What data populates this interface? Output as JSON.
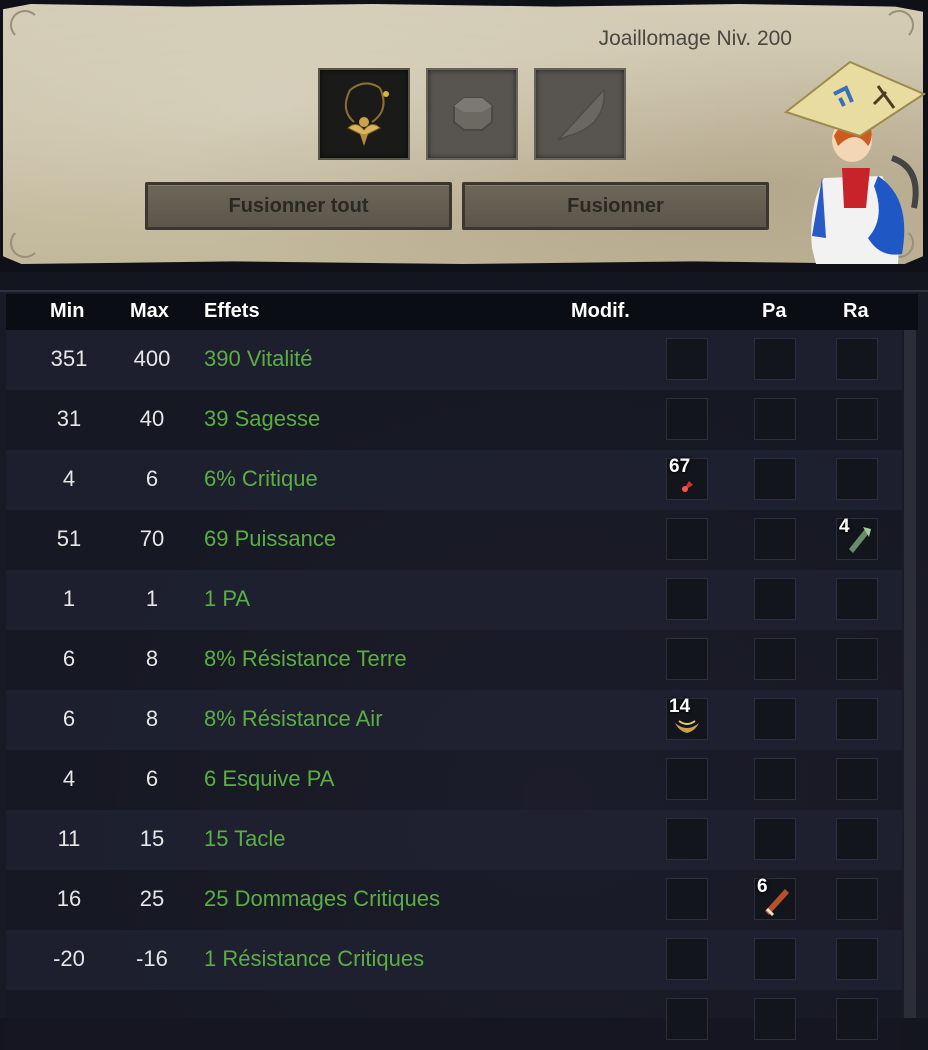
{
  "header": {
    "job_title": "Joaillomage Niv. 200",
    "slots": [
      {
        "icon": "amulet-icon",
        "state": "filled"
      },
      {
        "icon": "rune-slot-icon",
        "state": "empty"
      },
      {
        "icon": "feather-icon",
        "state": "empty"
      }
    ],
    "buttons": {
      "merge_all": "Fusionner tout",
      "merge": "Fusionner"
    }
  },
  "table": {
    "columns": {
      "min": "Min",
      "max": "Max",
      "effects": "Effets",
      "modif": "Modif.",
      "pa": "Pa",
      "ra": "Ra"
    },
    "rows": [
      {
        "min": "351",
        "max": "400",
        "effect": "390 Vitalité",
        "modif": "",
        "pa": "",
        "ra": ""
      },
      {
        "min": "31",
        "max": "40",
        "effect": "39 Sagesse",
        "modif": "",
        "pa": "",
        "ra": ""
      },
      {
        "min": "4",
        "max": "6",
        "effect": "6% Critique",
        "modif": "67",
        "pa": "",
        "ra": ""
      },
      {
        "min": "51",
        "max": "70",
        "effect": "69 Puissance",
        "modif": "",
        "pa": "",
        "ra": "4"
      },
      {
        "min": "1",
        "max": "1",
        "effect": "1 PA",
        "modif": "",
        "pa": "",
        "ra": ""
      },
      {
        "min": "6",
        "max": "8",
        "effect": "8% Résistance Terre",
        "modif": "",
        "pa": "",
        "ra": ""
      },
      {
        "min": "6",
        "max": "8",
        "effect": "8% Résistance Air",
        "modif": "14",
        "pa": "",
        "ra": ""
      },
      {
        "min": "4",
        "max": "6",
        "effect": "6 Esquive PA",
        "modif": "",
        "pa": "",
        "ra": ""
      },
      {
        "min": "11",
        "max": "15",
        "effect": "15 Tacle",
        "modif": "",
        "pa": "",
        "ra": ""
      },
      {
        "min": "16",
        "max": "25",
        "effect": "25 Dommages Critiques",
        "modif": "",
        "pa": "6",
        "ra": ""
      },
      {
        "min": "-20",
        "max": "-16",
        "effect": "1 Résistance Critiques",
        "modif": "",
        "pa": "",
        "ra": ""
      },
      {
        "min": "",
        "max": "",
        "effect": "",
        "modif": "",
        "pa": "",
        "ra": ""
      }
    ]
  },
  "colors": {
    "effect_text": "#5bae44",
    "header_bg": "#0b0d14",
    "parchment": "#cbc2a8"
  }
}
